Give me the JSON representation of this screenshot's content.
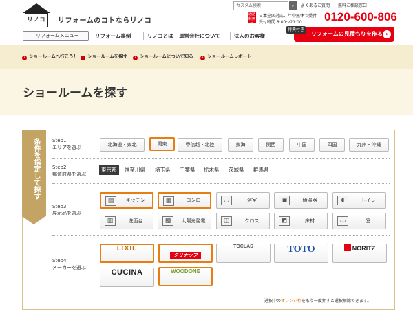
{
  "header": {
    "logo_text": "リノコ",
    "tagline": "リフォームのコトならリノコ",
    "search_placeholder": "カスタム検索",
    "links": [
      "よくあるご質問",
      "無料ご相談窓口"
    ],
    "freecall": "通話料無料",
    "hours_line1": "日本全国対応、年中無休で受付",
    "hours_line2": "受付時間 8:00～21:00",
    "phone": "0120-600-806",
    "badge": "特典付き",
    "cta": "リフォームの見積もりを作る",
    "accent": "#e60012"
  },
  "nav": {
    "menu_label": "リフォームメニュー",
    "items": [
      "リフォーム事例",
      "リノコとは",
      "運営会社について",
      "法人のお客様"
    ]
  },
  "subnav": [
    "ショールームへ行こう！",
    "ショールームを探す",
    "ショールームについて知る",
    "ショールームレポート"
  ],
  "page_title": "ショールームを探す",
  "side_tab": "条件を指定して探す",
  "step1": {
    "step": "Step1",
    "label": "エリアを選ぶ",
    "areas": [
      "北海道・東北",
      "関東",
      "甲信越・北陸",
      "東海",
      "関西",
      "中国",
      "四国",
      "九州・沖縄"
    ],
    "selected": "関東"
  },
  "step2": {
    "step": "Step2",
    "label": "都道府県を選ぶ",
    "prefs": [
      "東京都",
      "神奈川県",
      "埼玉県",
      "千葉県",
      "栃木県",
      "茨城県",
      "群馬県"
    ],
    "selected": "東京都"
  },
  "step3": {
    "step": "Step3",
    "label": "展示品を選ぶ",
    "products": [
      {
        "label": "キッチン",
        "icon": "kitchen-icon",
        "glyph": "▤"
      },
      {
        "label": "コンロ",
        "icon": "stove-icon",
        "glyph": "▦"
      },
      {
        "label": "浴室",
        "icon": "bath-icon",
        "glyph": "◡"
      },
      {
        "label": "給湯器",
        "icon": "water-heater-icon",
        "glyph": "▣"
      },
      {
        "label": "トイレ",
        "icon": "toilet-icon",
        "glyph": "◖"
      },
      {
        "label": "洗面台",
        "icon": "washbasin-icon",
        "glyph": "▥"
      },
      {
        "label": "太陽光発電",
        "icon": "solar-icon",
        "glyph": "▩"
      },
      {
        "label": "クロス",
        "icon": "wallpaper-icon",
        "glyph": "◫"
      },
      {
        "label": "床材",
        "icon": "floor-icon",
        "glyph": "◩"
      },
      {
        "label": "窓",
        "icon": "window-icon",
        "glyph": "▭"
      }
    ],
    "selected": [
      "キッチン",
      "コンロ"
    ]
  },
  "step4": {
    "step": "Step4",
    "label": "メーカーを選ぶ",
    "makers": [
      "LIXIL",
      "クリナップ",
      "TOCLAS",
      "TOTO",
      "NORITZ",
      "CUCINA",
      "WOODONE"
    ],
    "selected": [
      "LIXIL",
      "クリナップ",
      "WOODONE"
    ]
  },
  "footnote": {
    "pre": "選択中の",
    "orange": "オレンジ枠",
    "post": "をもう一度押すと選択解除できます。"
  },
  "colors": {
    "highlight": "#e87e12",
    "band": "#f6ecd0",
    "tab": "#c3a464"
  }
}
